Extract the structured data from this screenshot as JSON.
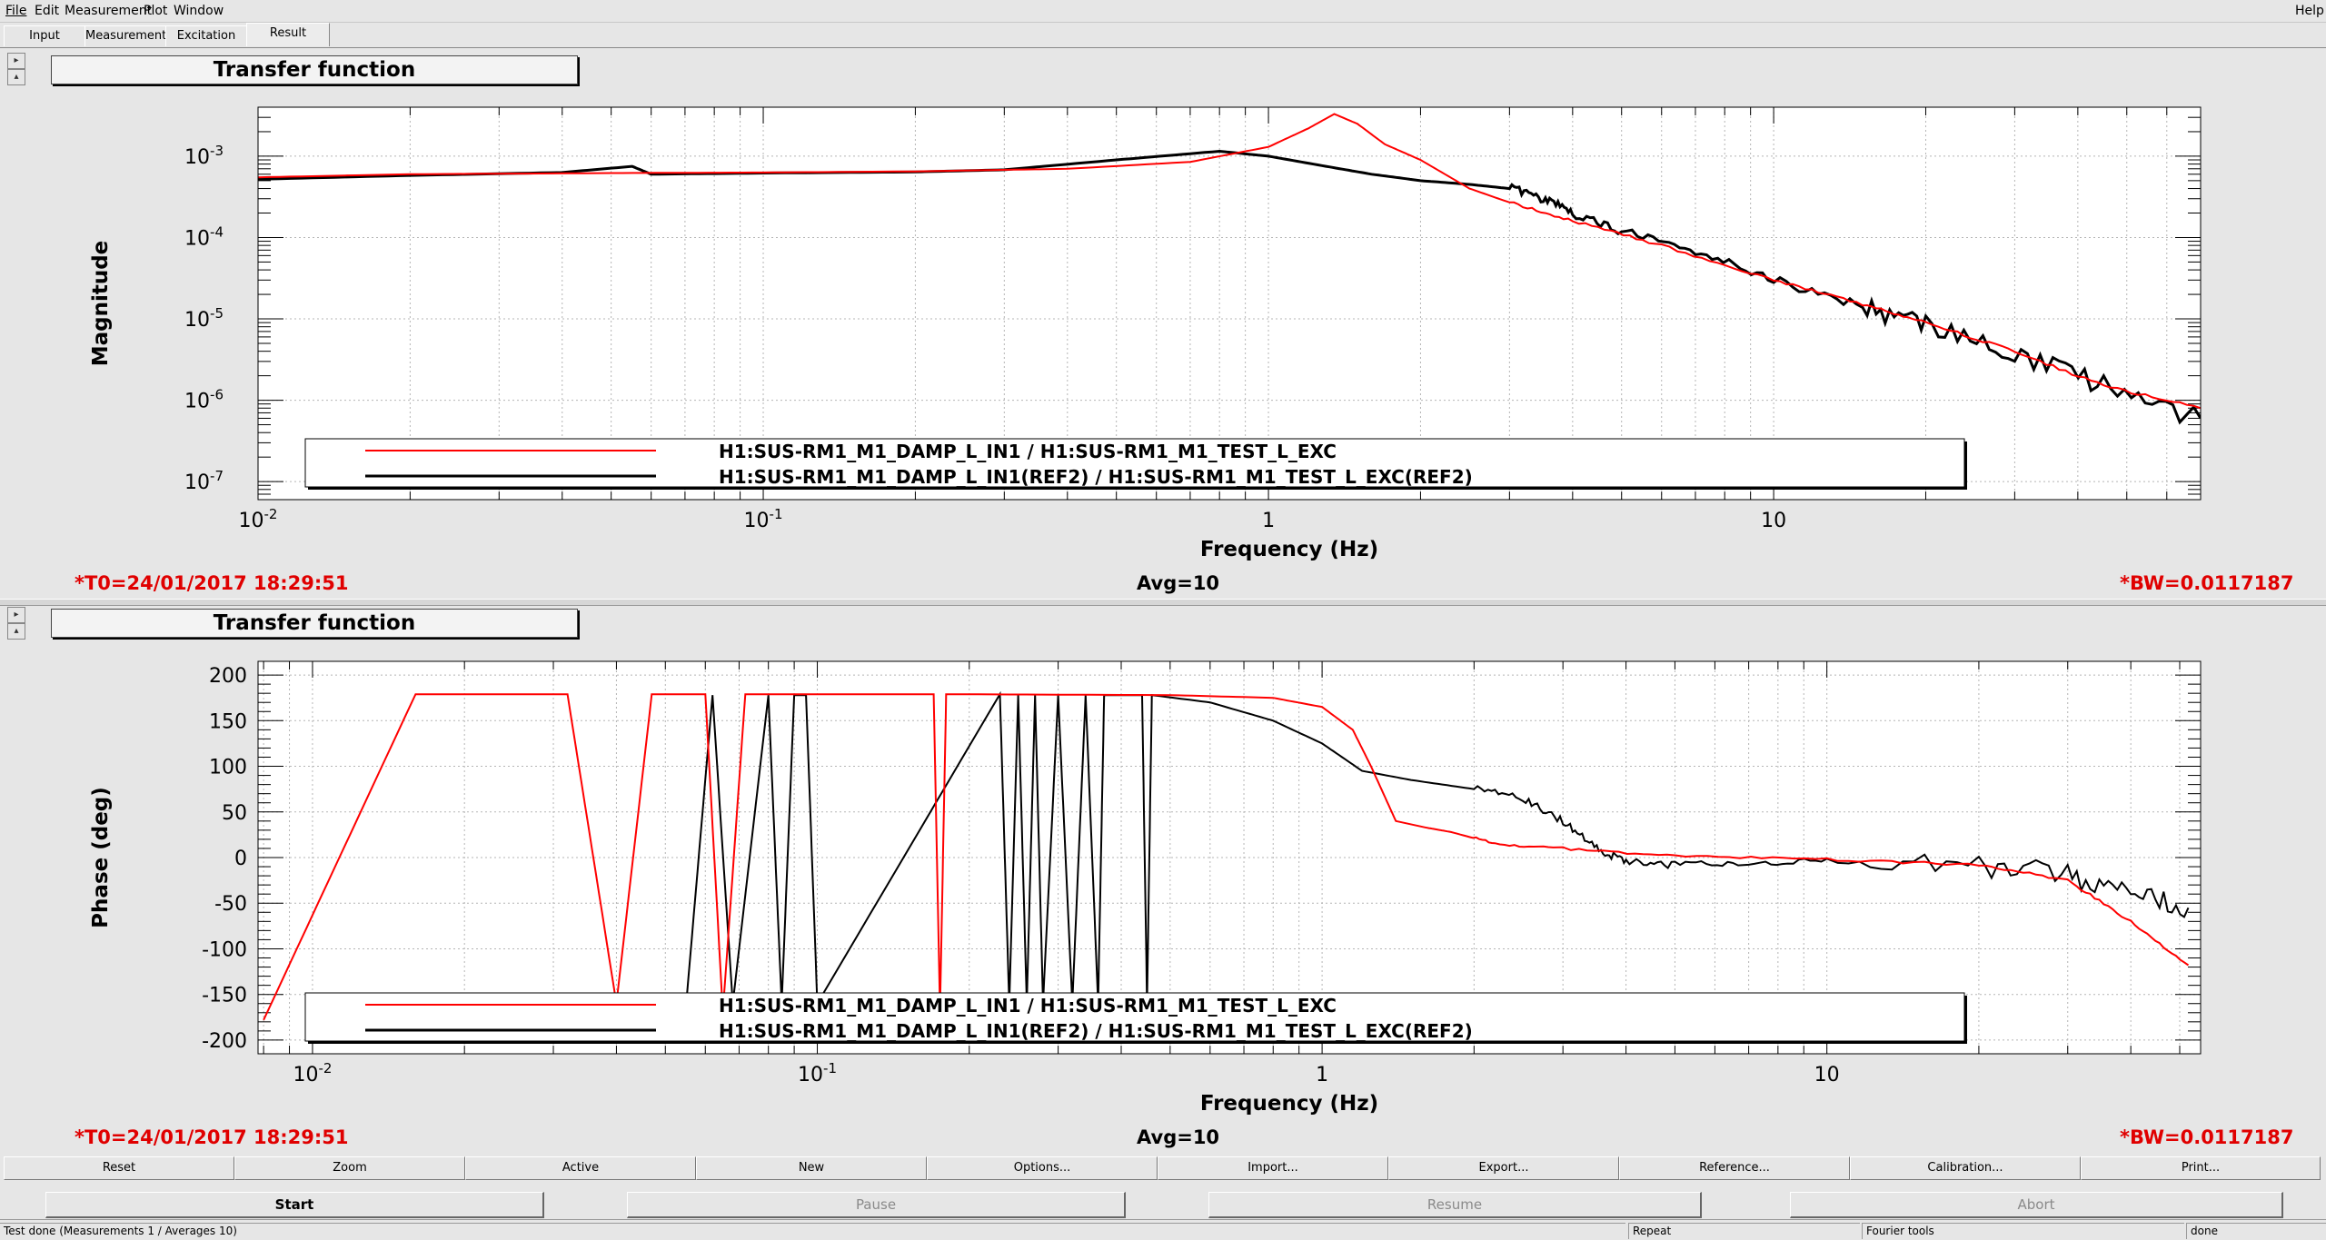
{
  "menu": {
    "file": "File",
    "edit": "Edit",
    "measurement": "Measurement",
    "plot": "Plot",
    "window": "Window",
    "help": "Help"
  },
  "tabs": [
    "Input",
    "Measurement",
    "Excitation",
    "Result"
  ],
  "active_tab": "Result",
  "side_buttons": {
    "expand": "▸",
    "collapse": "▴"
  },
  "panels": [
    {
      "title": "Transfer function",
      "status": {
        "t0": "*T0=24/01/2017 18:29:51",
        "avg": "Avg=10",
        "bw": "*BW=0.0117187"
      }
    },
    {
      "title": "Transfer function",
      "status": {
        "t0": "*T0=24/01/2017 18:29:51",
        "avg": "Avg=10",
        "bw": "*BW=0.0117187"
      }
    }
  ],
  "chart_data": [
    {
      "type": "line",
      "title": "Transfer function",
      "xlabel": "Frequency (Hz)",
      "ylabel": "Magnitude",
      "xscale": "log",
      "yscale": "log",
      "xlim": [
        0.01,
        70
      ],
      "ylim": [
        6e-08,
        0.004
      ],
      "x_ticks": [
        {
          "v": 0.01,
          "b": "10",
          "e": "-2"
        },
        {
          "v": 0.1,
          "b": "10",
          "e": "-1"
        },
        {
          "v": 1,
          "b": "1",
          "e": ""
        },
        {
          "v": 10,
          "b": "10",
          "e": ""
        }
      ],
      "y_ticks": [
        {
          "v": 0.001,
          "b": "10",
          "e": "-3"
        },
        {
          "v": 0.0001,
          "b": "10",
          "e": "-4"
        },
        {
          "v": 1e-05,
          "b": "10",
          "e": "-5"
        },
        {
          "v": 1e-06,
          "b": "10",
          "e": "-6"
        },
        {
          "v": 1e-07,
          "b": "10",
          "e": "-7"
        }
      ],
      "grid": true,
      "legend_position": "bottom",
      "series": [
        {
          "name": "H1:SUS-RM1_M1_DAMP_L_IN1 / H1:SUS-RM1_M1_TEST_L_EXC",
          "color": "#ff0000",
          "points": [
            [
              0.01,
              0.00055
            ],
            [
              0.02,
              0.0006
            ],
            [
              0.05,
              0.00062
            ],
            [
              0.1,
              0.00063
            ],
            [
              0.2,
              0.00065
            ],
            [
              0.4,
              0.0007
            ],
            [
              0.7,
              0.00085
            ],
            [
              1.0,
              0.0013
            ],
            [
              1.2,
              0.0022
            ],
            [
              1.35,
              0.0033
            ],
            [
              1.5,
              0.0025
            ],
            [
              1.7,
              0.0014
            ],
            [
              2.0,
              0.0009
            ],
            [
              2.5,
              0.0004
            ],
            [
              3.0,
              0.00027
            ],
            [
              4.0,
              0.00016
            ],
            [
              6.0,
              8e-05
            ],
            [
              10,
              3e-05
            ],
            [
              15,
              1.5e-05
            ],
            [
              20,
              9e-06
            ],
            [
              30,
              4e-06
            ],
            [
              45,
              1.5e-06
            ],
            [
              70,
              8e-07
            ]
          ]
        },
        {
          "name": "H1:SUS-RM1_M1_DAMP_L_IN1(REF2) / H1:SUS-RM1_M1_TEST_L_EXC(REF2)",
          "color": "#000000",
          "points": [
            [
              0.01,
              0.00052
            ],
            [
              0.02,
              0.00058
            ],
            [
              0.04,
              0.00063
            ],
            [
              0.055,
              0.00075
            ],
            [
              0.06,
              0.0006
            ],
            [
              0.1,
              0.00062
            ],
            [
              0.2,
              0.00064
            ],
            [
              0.3,
              0.00068
            ],
            [
              0.5,
              0.0009
            ],
            [
              0.8,
              0.00115
            ],
            [
              1.0,
              0.001
            ],
            [
              1.3,
              0.00075
            ],
            [
              1.6,
              0.0006
            ],
            [
              2.0,
              0.0005
            ],
            [
              2.5,
              0.00045
            ],
            [
              3.0,
              0.0004
            ],
            [
              3.5,
              0.0003
            ],
            [
              4.0,
              0.0002
            ],
            [
              5.0,
              0.00012
            ],
            [
              7.0,
              7e-05
            ],
            [
              10,
              3e-05
            ],
            [
              15,
              1.4e-05
            ],
            [
              20,
              9e-06
            ],
            [
              30,
              4e-06
            ],
            [
              45,
              1.5e-06
            ],
            [
              70,
              6e-07
            ]
          ]
        }
      ]
    },
    {
      "type": "line",
      "title": "Transfer function",
      "xlabel": "Frequency (Hz)",
      "ylabel": "Phase (deg)",
      "xscale": "log",
      "yscale": "linear",
      "xlim": [
        0.0078,
        55
      ],
      "ylim": [
        -215,
        215
      ],
      "x_ticks": [
        {
          "v": 0.01,
          "b": "10",
          "e": "-2"
        },
        {
          "v": 0.1,
          "b": "10",
          "e": "-1"
        },
        {
          "v": 1,
          "b": "1",
          "e": ""
        },
        {
          "v": 10,
          "b": "10",
          "e": ""
        }
      ],
      "y_ticks": [
        200,
        150,
        100,
        50,
        0,
        -50,
        -100,
        -150,
        -200
      ],
      "grid": true,
      "legend_position": "bottom",
      "series": [
        {
          "name": "H1:SUS-RM1_M1_DAMP_L_IN1 / H1:SUS-RM1_M1_TEST_L_EXC",
          "color": "#ff0000",
          "points": [
            [
              0.008,
              -178
            ],
            [
              0.016,
              179
            ],
            [
              0.032,
              179
            ],
            [
              0.04,
              -160
            ],
            [
              0.047,
              179
            ],
            [
              0.06,
              179
            ],
            [
              0.065,
              -170
            ],
            [
              0.072,
              179
            ],
            [
              0.17,
              179
            ],
            [
              0.175,
              -170
            ],
            [
              0.18,
              179
            ],
            [
              0.5,
              178
            ],
            [
              0.8,
              175
            ],
            [
              1.0,
              165
            ],
            [
              1.15,
              140
            ],
            [
              1.25,
              100
            ],
            [
              1.4,
              40
            ],
            [
              1.6,
              33
            ],
            [
              1.8,
              28
            ],
            [
              2.2,
              15
            ],
            [
              3.0,
              10
            ],
            [
              5,
              2
            ],
            [
              10,
              -2
            ],
            [
              20,
              -8
            ],
            [
              30,
              -25
            ],
            [
              40,
              -70
            ],
            [
              52,
              -118
            ]
          ]
        },
        {
          "name": "H1:SUS-RM1_M1_DAMP_L_IN1(REF2) / H1:SUS-RM1_M1_TEST_L_EXC(REF2)",
          "color": "#000000",
          "points": [
            [
              0.055,
              -160
            ],
            [
              0.062,
              178
            ],
            [
              0.068,
              -160
            ],
            [
              0.08,
              178
            ],
            [
              0.085,
              -160
            ],
            [
              0.09,
              178
            ],
            [
              0.095,
              178
            ],
            [
              0.1,
              -160
            ],
            [
              0.23,
              179
            ],
            [
              0.24,
              -160
            ],
            [
              0.25,
              178
            ],
            [
              0.26,
              -160
            ],
            [
              0.27,
              178
            ],
            [
              0.28,
              -160
            ],
            [
              0.3,
              178
            ],
            [
              0.32,
              -160
            ],
            [
              0.34,
              178
            ],
            [
              0.36,
              -160
            ],
            [
              0.37,
              178
            ],
            [
              0.44,
              178
            ],
            [
              0.45,
              -160
            ],
            [
              0.46,
              178
            ],
            [
              0.6,
              170
            ],
            [
              0.8,
              150
            ],
            [
              1.0,
              125
            ],
            [
              1.2,
              95
            ],
            [
              1.5,
              85
            ],
            [
              2.0,
              75
            ],
            [
              2.5,
              65
            ],
            [
              3.0,
              40
            ],
            [
              3.5,
              10
            ],
            [
              4.0,
              -5
            ],
            [
              5,
              -8
            ],
            [
              7,
              -5
            ],
            [
              10,
              -3
            ],
            [
              20,
              -8
            ],
            [
              30,
              -20
            ],
            [
              40,
              -40
            ],
            [
              52,
              -55
            ]
          ]
        }
      ]
    }
  ],
  "toolbar_buttons": [
    "Reset",
    "Zoom",
    "Active",
    "New",
    "Options...",
    "Import...",
    "Export...",
    "Reference...",
    "Calibration...",
    "Print..."
  ],
  "control_buttons": {
    "start": "Start",
    "pause": "Pause",
    "resume": "Resume",
    "abort": "Abort"
  },
  "statusbar": {
    "message": "Test done (Measurements 1 / Averages 10)",
    "repeat": "Repeat",
    "fourier": "Fourier tools",
    "state": "done"
  }
}
